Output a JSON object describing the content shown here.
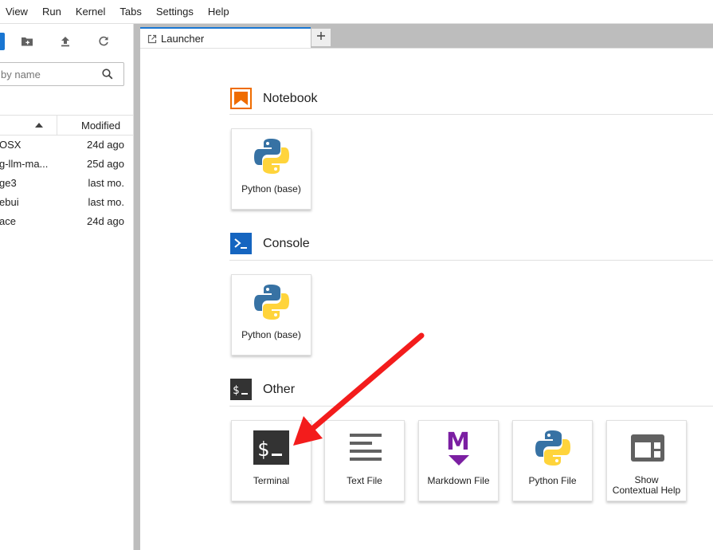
{
  "menu": [
    "View",
    "Run",
    "Kernel",
    "Tabs",
    "Settings",
    "Help"
  ],
  "file_browser": {
    "filter_placeholder": "by name",
    "columns": {
      "modified": "Modified"
    },
    "files": [
      {
        "name": "OSX",
        "modified": "24d ago"
      },
      {
        "name": "g-llm-ma...",
        "modified": "25d ago"
      },
      {
        "name": "ge3",
        "modified": "last mo."
      },
      {
        "name": "ebui",
        "modified": "last mo."
      },
      {
        "name": "ace",
        "modified": "24d ago"
      }
    ]
  },
  "tabs": [
    {
      "label": "Launcher"
    }
  ],
  "launcher": {
    "sections": {
      "notebook": {
        "title": "Notebook",
        "items": [
          "Python (base)"
        ]
      },
      "console": {
        "title": "Console",
        "items": [
          "Python (base)"
        ]
      },
      "other": {
        "title": "Other",
        "items": [
          "Terminal",
          "Text File",
          "Markdown File",
          "Python File",
          "Show",
          "Contextual Help"
        ]
      }
    }
  },
  "colors": {
    "accent": "#1976d2",
    "notebook_icon": "#ef6c00",
    "console_icon": "#1565c0",
    "terminal_icon": "#333333",
    "markdown_icon": "#7b1fa2",
    "python_blue": "#3772a4",
    "python_yellow": "#ffd43b",
    "annotation_arrow": "#f31c1c"
  }
}
